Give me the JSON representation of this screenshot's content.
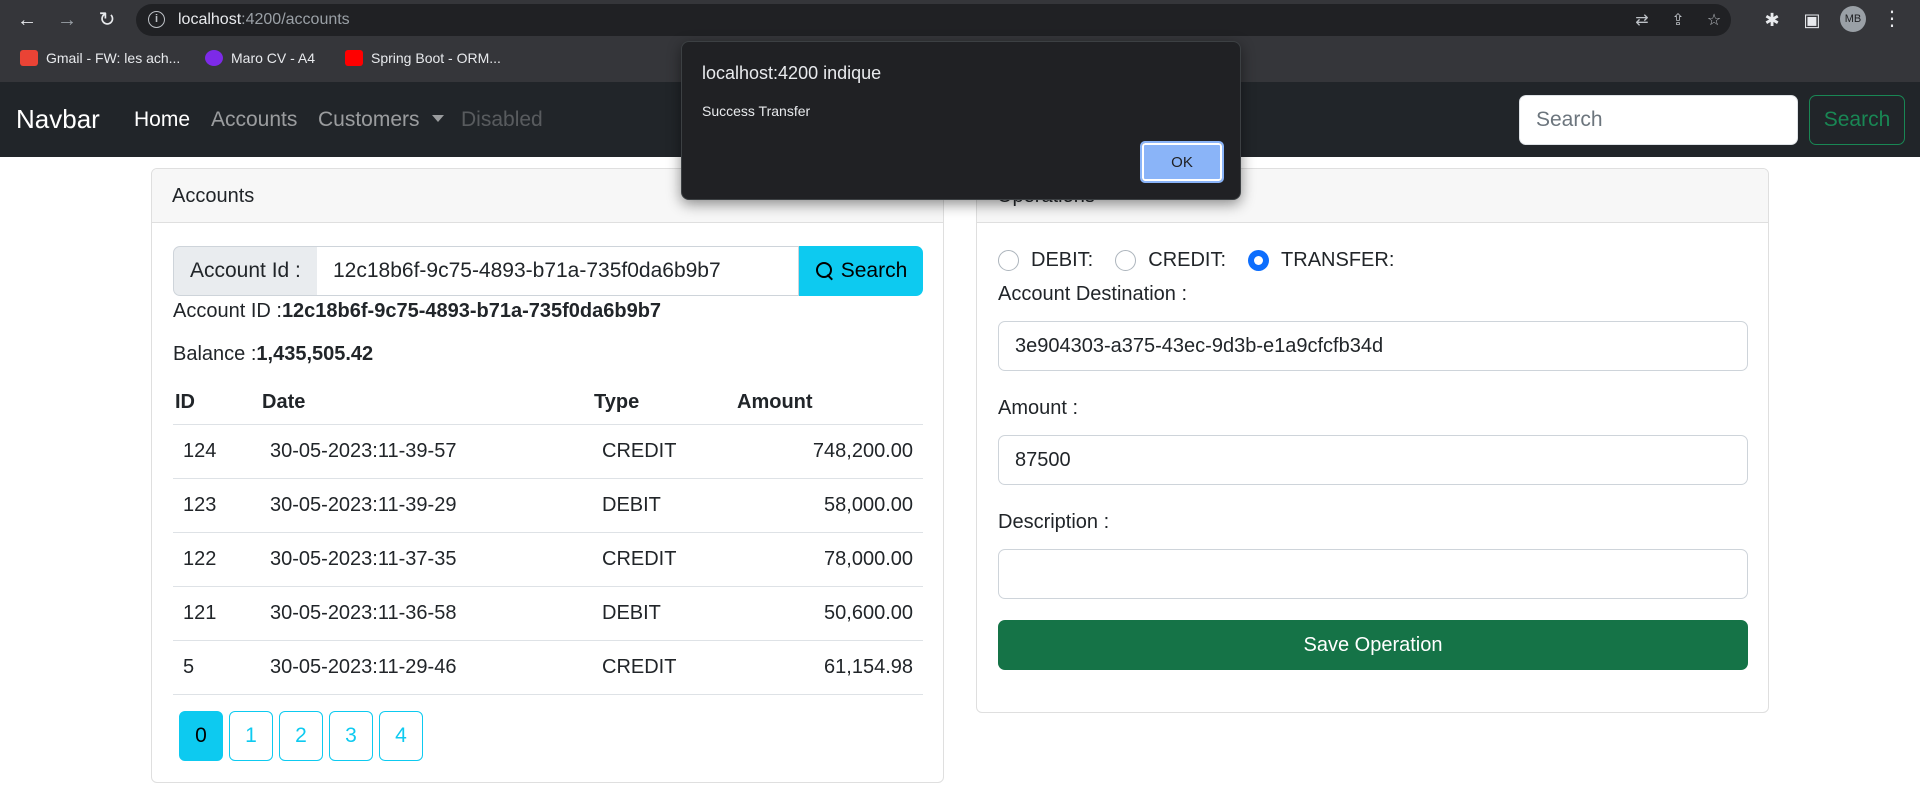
{
  "browser": {
    "url_host": "localhost",
    "url_path": ":4200/accounts",
    "avatar_initials": "MB",
    "bookmarks": [
      {
        "label": "Gmail - FW: les ach...",
        "icon": "gmail-icon",
        "color": "#ea4335"
      },
      {
        "label": "Maro CV - A4",
        "icon": "canva-icon",
        "color": "#7d2ae8"
      },
      {
        "label": "Spring Boot - ORM...",
        "icon": "youtube-icon",
        "color": "#ff0000"
      }
    ]
  },
  "navbar": {
    "brand": "Navbar",
    "links": {
      "home": "Home",
      "accounts": "Accounts",
      "customers": "Customers",
      "disabled": "Disabled"
    },
    "search_placeholder": "Search",
    "search_button": "Search"
  },
  "accounts_card": {
    "header": "Accounts",
    "account_id_label": "Account Id :",
    "account_id_value": "12c18b6f-9c75-4893-b71a-735f0da6b9b7",
    "search_button": "Search",
    "account_id_prefix": "Account ID :",
    "account_id_display": "12c18b6f-9c75-4893-b71a-735f0da6b9b7",
    "balance_prefix": "Balance :",
    "balance_value": "1,435,505.42",
    "columns": {
      "id": "ID",
      "date": "Date",
      "type": "Type",
      "amount": "Amount"
    },
    "rows": [
      {
        "id": "124",
        "date": "30-05-2023:11-39-57",
        "type": "CREDIT",
        "amount": "748,200.00"
      },
      {
        "id": "123",
        "date": "30-05-2023:11-39-29",
        "type": "DEBIT",
        "amount": "58,000.00"
      },
      {
        "id": "122",
        "date": "30-05-2023:11-37-35",
        "type": "CREDIT",
        "amount": "78,000.00"
      },
      {
        "id": "121",
        "date": "30-05-2023:11-36-58",
        "type": "DEBIT",
        "amount": "50,600.00"
      },
      {
        "id": "5",
        "date": "30-05-2023:11-29-46",
        "type": "CREDIT",
        "amount": "61,154.98"
      }
    ],
    "pages": [
      "0",
      "1",
      "2",
      "3",
      "4"
    ],
    "active_page": "0"
  },
  "operations_card": {
    "header": "Operations",
    "radio_debit": "DEBIT:",
    "radio_credit": "CREDIT:",
    "radio_transfer": "TRANSFER:",
    "selected_operation": "TRANSFER",
    "destination_label": "Account Destination :",
    "destination_value": "3e904303-a375-43ec-9d3b-e1a9cfcfb34d",
    "amount_label": "Amount :",
    "amount_value": "87500",
    "description_label": "Description :",
    "description_value": "",
    "save_button": "Save Operation"
  },
  "alert": {
    "title": "localhost:4200 indique",
    "message": "Success Transfer",
    "ok_button": "OK"
  },
  "colors": {
    "navbar_bg": "#212529",
    "info": "#0dcaf0",
    "success_outline": "#198754",
    "save_button": "#157347",
    "radio_checked": "#0d6efd"
  }
}
